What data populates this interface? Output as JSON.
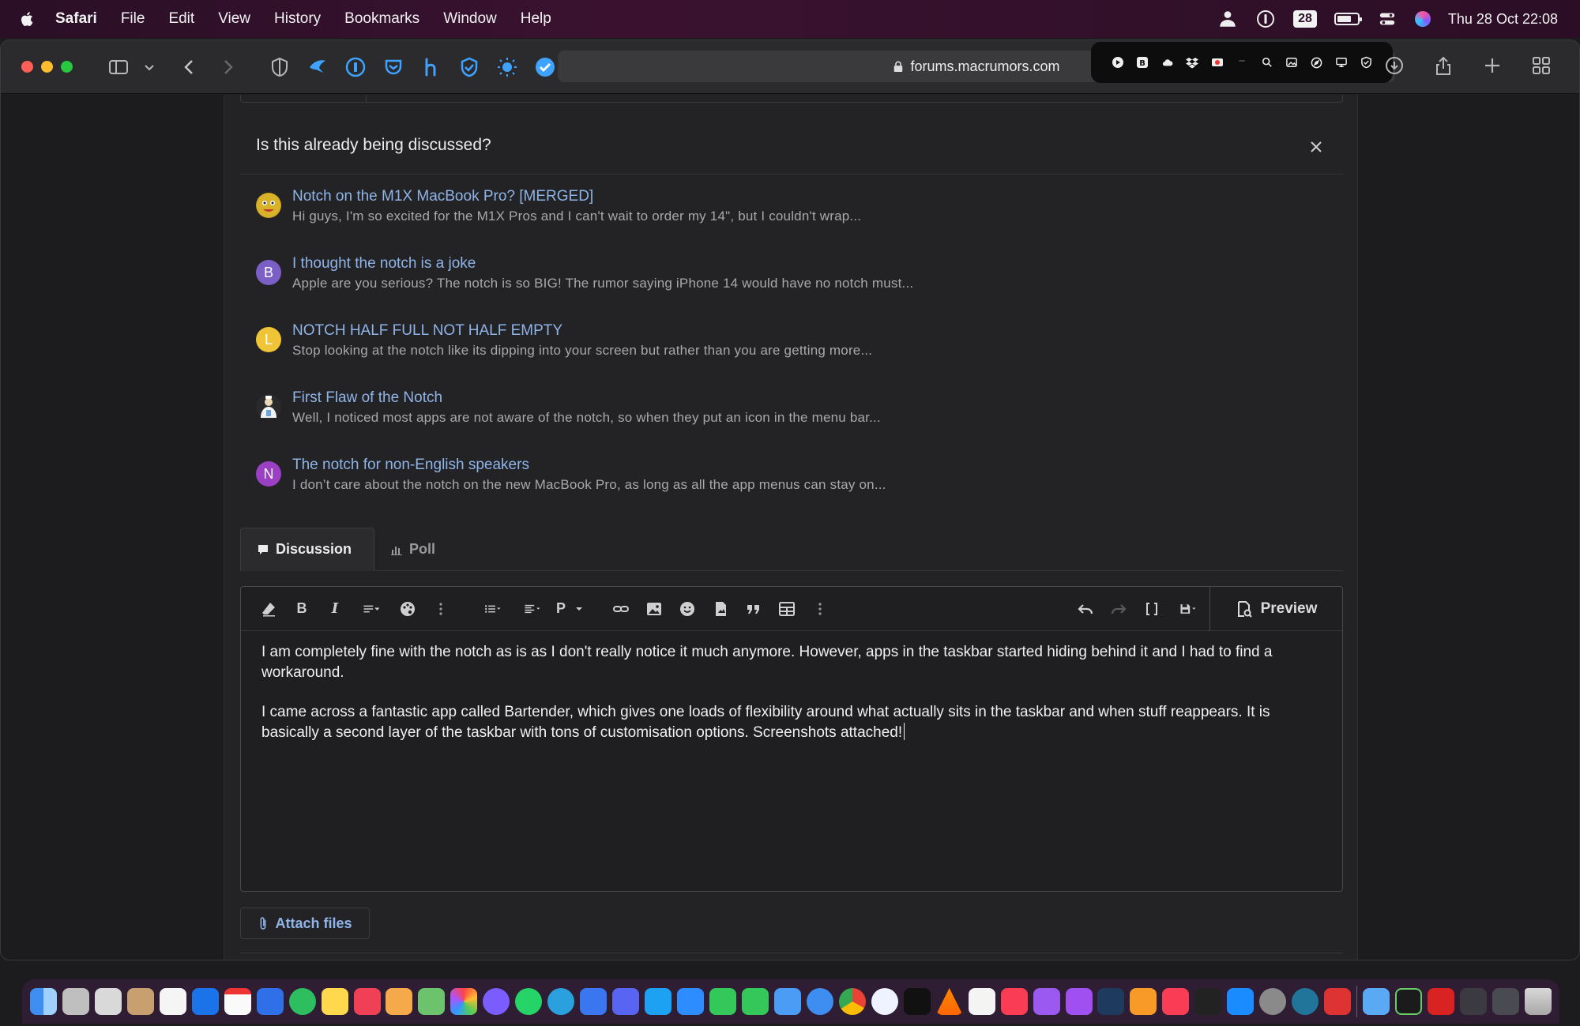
{
  "menubar": {
    "app_name": "Safari",
    "items": [
      "File",
      "Edit",
      "View",
      "History",
      "Bookmarks",
      "Window",
      "Help"
    ],
    "calendar_badge": "28",
    "clock": "Thu 28 Oct  22:08"
  },
  "browser": {
    "url": "forums.macrumors.com"
  },
  "similar_threads": {
    "heading": "Is this already being discussed?",
    "items": [
      {
        "title": "Notch on the M1X MacBook Pro? [MERGED]",
        "snippet": "Hi guys, I'm so excited for the M1X Pros and I can't wait to order my 14\", but I couldn't wrap...",
        "avatar_letter": "",
        "avatar_color": "#c9a227"
      },
      {
        "title": "I thought the notch is a joke",
        "snippet": "Apple are you serious? The notch is so BIG! The rumor saying iPhone 14 would have no notch must...",
        "avatar_letter": "B",
        "avatar_color": "#7b5fc7"
      },
      {
        "title": "NOTCH HALF FULL NOT HALF EMPTY",
        "snippet": "Stop looking at the notch like its dipping into your screen but rather than you are getting more...",
        "avatar_letter": "L",
        "avatar_color": "#f0c437"
      },
      {
        "title": "First Flaw of the Notch",
        "snippet": "Well, I noticed most apps are not aware of the notch, so when they put an icon in the menu bar...",
        "avatar_letter": "",
        "avatar_color": "#3a3a3c"
      },
      {
        "title": "The notch for non-English speakers",
        "snippet": "I don’t care about the notch on the new MacBook Pro, as long as all the app menus can stay on...",
        "avatar_letter": "N",
        "avatar_color": "#9b3fc4"
      }
    ]
  },
  "tabs": {
    "discussion": "Discussion",
    "poll": "Poll"
  },
  "editor": {
    "preview_label": "Preview",
    "paragraph_style": "P",
    "paragraphs": [
      "I am completely fine with the notch as is as I don't really notice it much anymore. However, apps in the taskbar started hiding behind it and I had to find a workaround.",
      "I came across a fantastic app called Bartender, which gives one loads of flexibility around what actually sits in the taskbar and when stuff reappears. It is basically a second layer of the taskbar with tons of customisation options. Screenshots attached!"
    ]
  },
  "attach_label": "Attach files",
  "colors": {
    "link": "#8fb4e8",
    "background": "#232325",
    "menubar": "#2a0f26"
  }
}
